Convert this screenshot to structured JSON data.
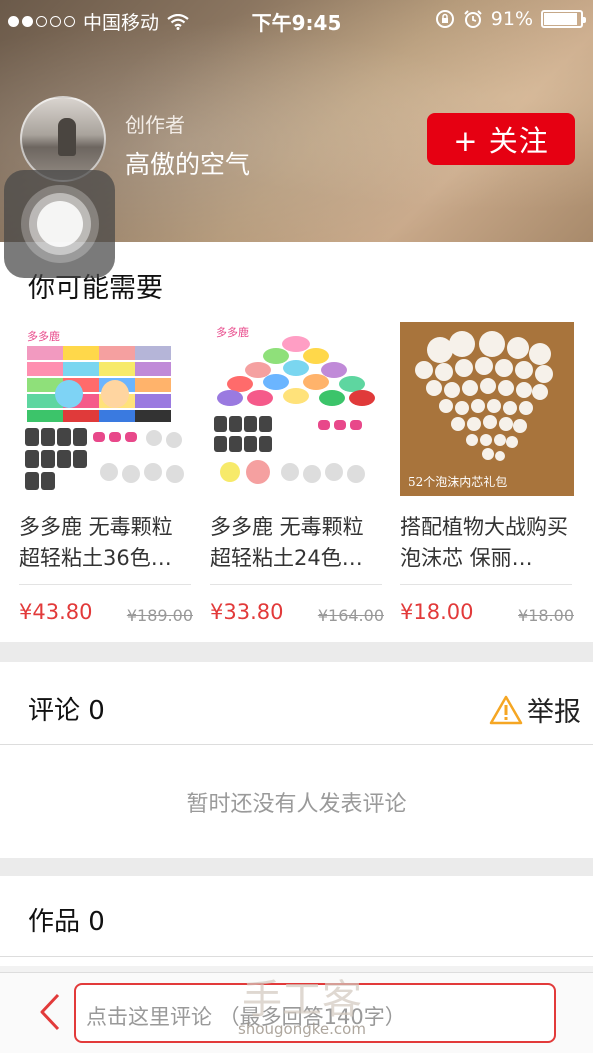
{
  "status_bar": {
    "carrier": "中国移动",
    "time": "下午9:45",
    "battery_percent": "91%",
    "battery_level": 0.91,
    "signal_bars_filled": 2,
    "signal_bars_total": 5
  },
  "creator": {
    "label": "创作者",
    "name": "高傲的空气",
    "follow_label": "+ 关注"
  },
  "recommend": {
    "title": "你可能需要",
    "products": [
      {
        "name": "多多鹿 无毒颗粒超轻粘土36色…",
        "price": "¥43.80",
        "old_price": "¥189.00",
        "brand": "多多鹿"
      },
      {
        "name": "多多鹿 无毒颗粒超轻粘土24色…",
        "price": "¥33.80",
        "old_price": "¥164.00",
        "brand": "多多鹿"
      },
      {
        "name": "搭配植物大战购买泡沫芯 保丽…",
        "price": "¥18.00",
        "old_price": "¥18.00",
        "caption": "52个泡沫内芯礼包"
      }
    ]
  },
  "comments": {
    "title": "评论 0",
    "report_label": "举报",
    "empty_text": "暂时还没有人发表评论"
  },
  "works": {
    "title": "作品 0"
  },
  "bottom": {
    "placeholder": "点击这里评论 （最多回答140字）",
    "watermark_big": "手工客",
    "watermark_small": "shougongke.com"
  },
  "colors": {
    "accent": "#e60012",
    "price": "#e23a3a",
    "warning": "#f5a623"
  }
}
